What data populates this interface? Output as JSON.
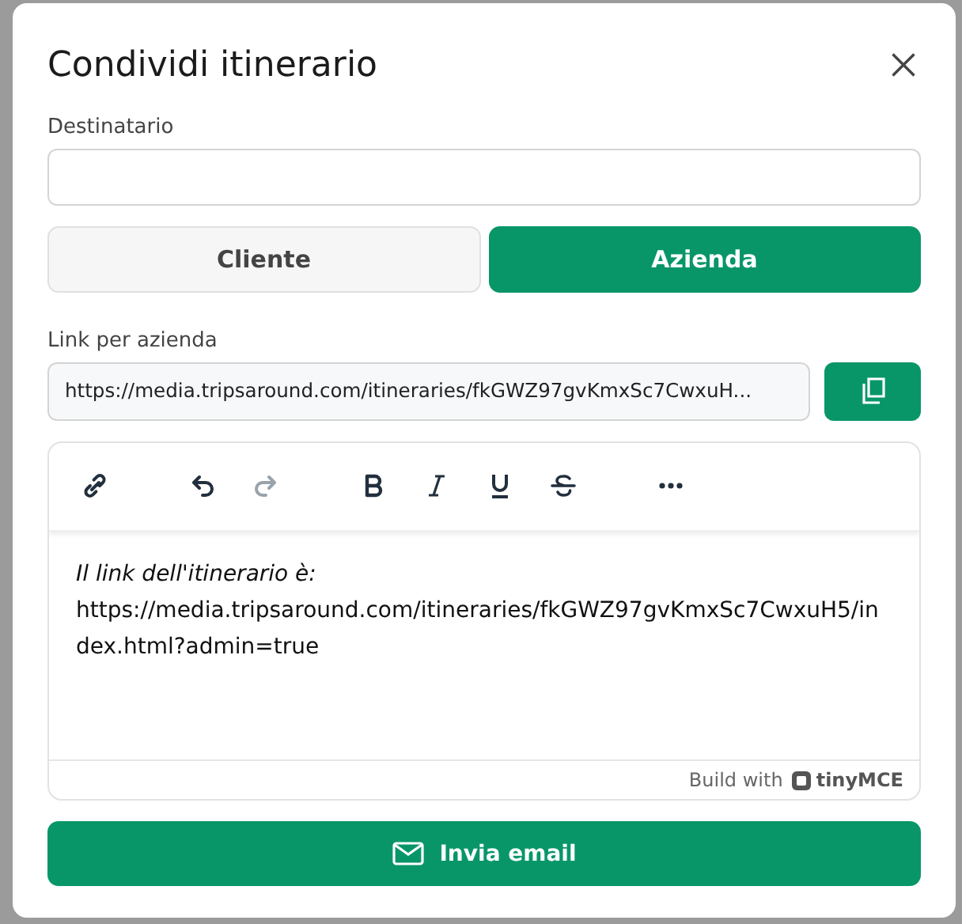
{
  "dialog": {
    "title": "Condividi itinerario"
  },
  "recipient": {
    "label": "Destinatario"
  },
  "recipient_type": [
    {
      "label": "Cliente",
      "selected": false
    },
    {
      "label": "Azienda",
      "selected": true
    }
  ],
  "link": {
    "label": "Link per azienda",
    "value": "https://media.tripsaround.com/itineraries/fkGWZ97gvKmxSc7CwxuH..."
  },
  "editor": {
    "toolbar": [
      {
        "kind": "link",
        "disabled": false
      },
      {
        "kind": "undo",
        "disabled": false
      },
      {
        "kind": "redo",
        "disabled": true
      },
      {
        "kind": "bold",
        "disabled": false
      },
      {
        "kind": "italic",
        "disabled": false
      },
      {
        "kind": "underline",
        "disabled": false
      },
      {
        "kind": "strikethrough",
        "disabled": false
      },
      {
        "kind": "more",
        "disabled": false
      }
    ],
    "content": [
      {
        "text": "Il link dell'itinerario è:",
        "italic": true
      },
      {
        "text": "https://media.tripsaround.com/itineraries/fkGWZ97gvKmxSc7CwxuH5/index.html?admin=true",
        "italic": false
      }
    ],
    "branding": {
      "text": "Build with",
      "logo": "tinyMCE"
    }
  },
  "send_button": {
    "label": "Invia email"
  }
}
